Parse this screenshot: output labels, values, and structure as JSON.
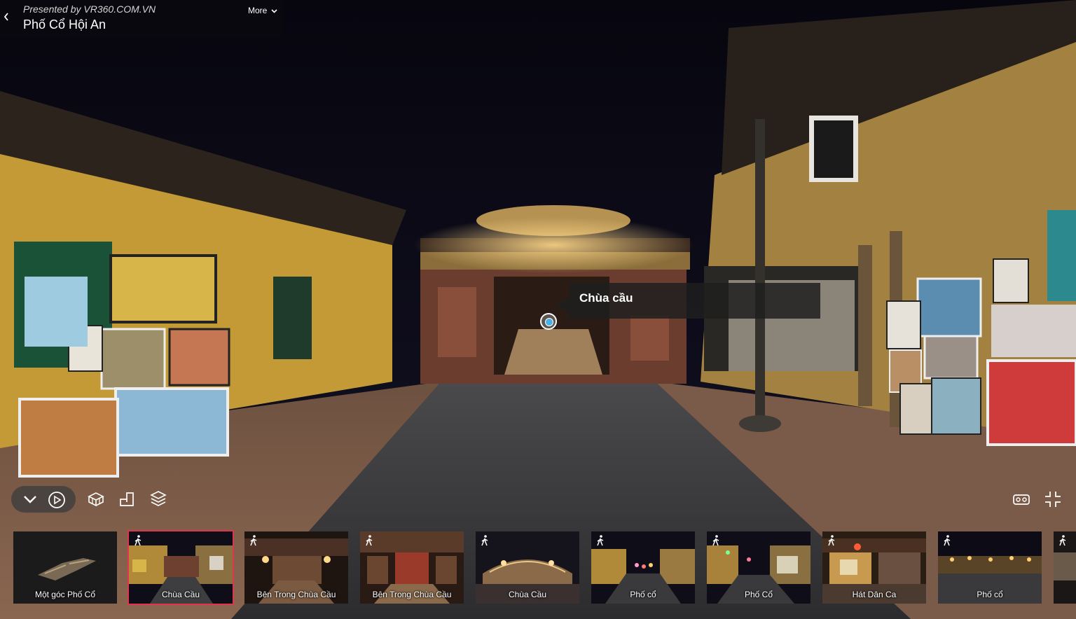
{
  "header": {
    "presented_by": "Presented by VR360.COM.VN",
    "title": "Phố Cổ Hội An",
    "more_label": "More"
  },
  "hotspot": {
    "label": "Chùa cầu"
  },
  "controls": {
    "icons": [
      "chevron-down-icon",
      "play-icon",
      "3d-model-icon",
      "floorplan-icon",
      "layers-icon",
      "vr-headset-icon",
      "exit-fullscreen-icon"
    ]
  },
  "thumbnails": [
    {
      "label": "Một góc Phố Cổ",
      "walk_icon": false,
      "active": false
    },
    {
      "label": "Chùa Cầu",
      "walk_icon": true,
      "active": true
    },
    {
      "label": "Bên Trong Chùa Cầu",
      "walk_icon": true,
      "active": false
    },
    {
      "label": "Bên Trong Chùa Cầu",
      "walk_icon": true,
      "active": false
    },
    {
      "label": "Chùa Cầu",
      "walk_icon": true,
      "active": false
    },
    {
      "label": "Phố cổ",
      "walk_icon": true,
      "active": false
    },
    {
      "label": "Phố Cổ",
      "walk_icon": true,
      "active": false
    },
    {
      "label": "Hát Dân Ca",
      "walk_icon": true,
      "active": false
    },
    {
      "label": "Phố cổ",
      "walk_icon": true,
      "active": false
    },
    {
      "label": "",
      "walk_icon": true,
      "active": false
    }
  ],
  "colors": {
    "active_border": "#e0344f",
    "hotspot_dot": "#4ab0e8"
  }
}
